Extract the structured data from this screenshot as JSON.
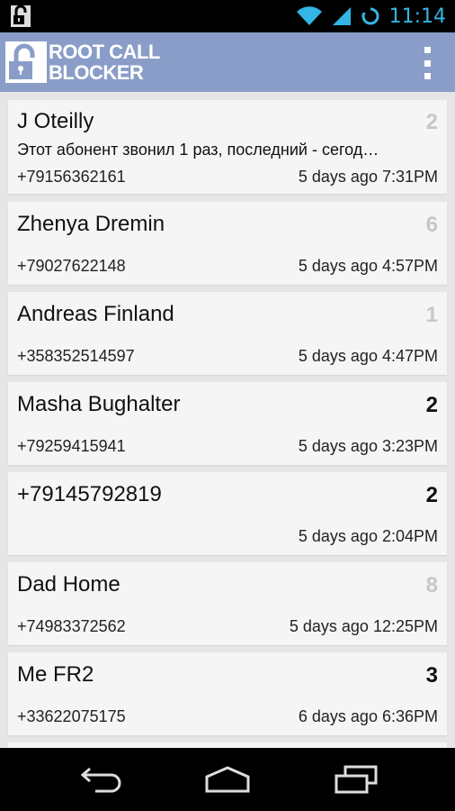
{
  "status_bar": {
    "time": "11:14",
    "icons": [
      "lock-notification-icon",
      "wifi-icon",
      "signal-icon",
      "sync-icon"
    ]
  },
  "action_bar": {
    "title_line1": "ROOT CALL",
    "title_line2": "BLOCKER",
    "overflow_icon": "overflow-menu-icon"
  },
  "calls": [
    {
      "name": "J Oteilly",
      "count": "2",
      "count_style": "gray",
      "message": "Этот абонент звонил 1 раз, последний - сегод…",
      "number": "+79156362161",
      "time": "5 days ago 7:31PM"
    },
    {
      "name": "Zhenya Dremin",
      "count": "6",
      "count_style": "gray",
      "message": "",
      "number": "+79027622148",
      "time": "5 days ago 4:57PM"
    },
    {
      "name": "Andreas Finland",
      "count": "1",
      "count_style": "gray",
      "message": "",
      "number": "+358352514597",
      "time": "5 days ago 4:47PM"
    },
    {
      "name": "Masha Bughalter",
      "count": "2",
      "count_style": "black",
      "message": "",
      "number": "+79259415941",
      "time": "5 days ago 3:23PM"
    },
    {
      "name": "+79145792819",
      "count": "2",
      "count_style": "black",
      "message": "",
      "number": "",
      "time": "5 days ago 2:04PM"
    },
    {
      "name": "Dad Home",
      "count": "8",
      "count_style": "gray",
      "message": "",
      "number": "+74983372562",
      "time": "5 days ago 12:25PM"
    },
    {
      "name": "Me FR2",
      "count": "3",
      "count_style": "black",
      "message": "",
      "number": "+33622075175",
      "time": "6 days ago 6:36PM"
    },
    {
      "name": "",
      "count": "",
      "count_style": "gray",
      "message": "",
      "number": "",
      "time": ""
    }
  ],
  "nav_bar": {
    "back": "back-icon",
    "home": "home-icon",
    "recents": "recent-apps-icon"
  }
}
